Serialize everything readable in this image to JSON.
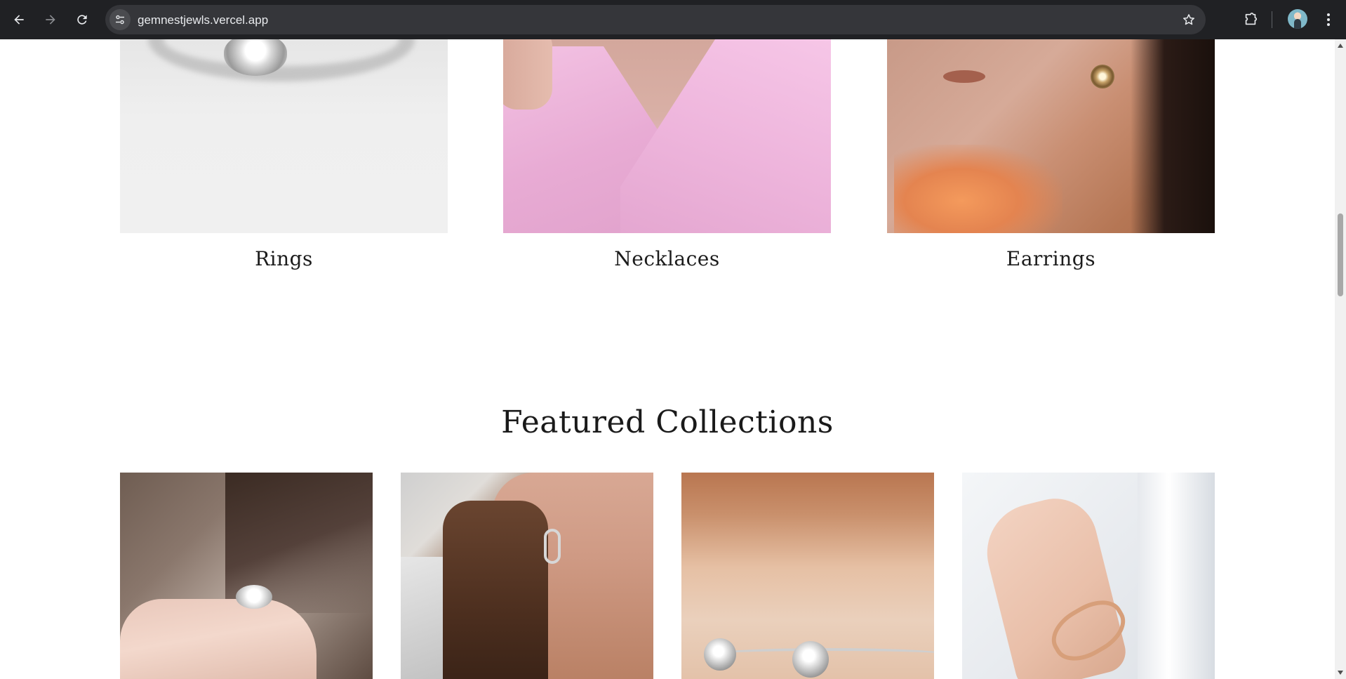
{
  "browser": {
    "url": "gemnestjewls.vercel.app",
    "icons": {
      "back": "arrow-left-icon",
      "forward": "arrow-right-icon",
      "reload": "reload-icon",
      "site_info": "tune-icon",
      "bookmark": "star-icon",
      "extensions": "puzzle-icon",
      "profile": "avatar",
      "menu": "kebab-menu-icon"
    }
  },
  "categories": [
    {
      "label": "Rings"
    },
    {
      "label": "Necklaces"
    },
    {
      "label": "Earrings"
    }
  ],
  "featured": {
    "title": "Featured Collections"
  },
  "colors": {
    "chrome_bg": "#202124",
    "omnibox_bg": "#35363a",
    "heading_text": "#1a1a1a"
  }
}
